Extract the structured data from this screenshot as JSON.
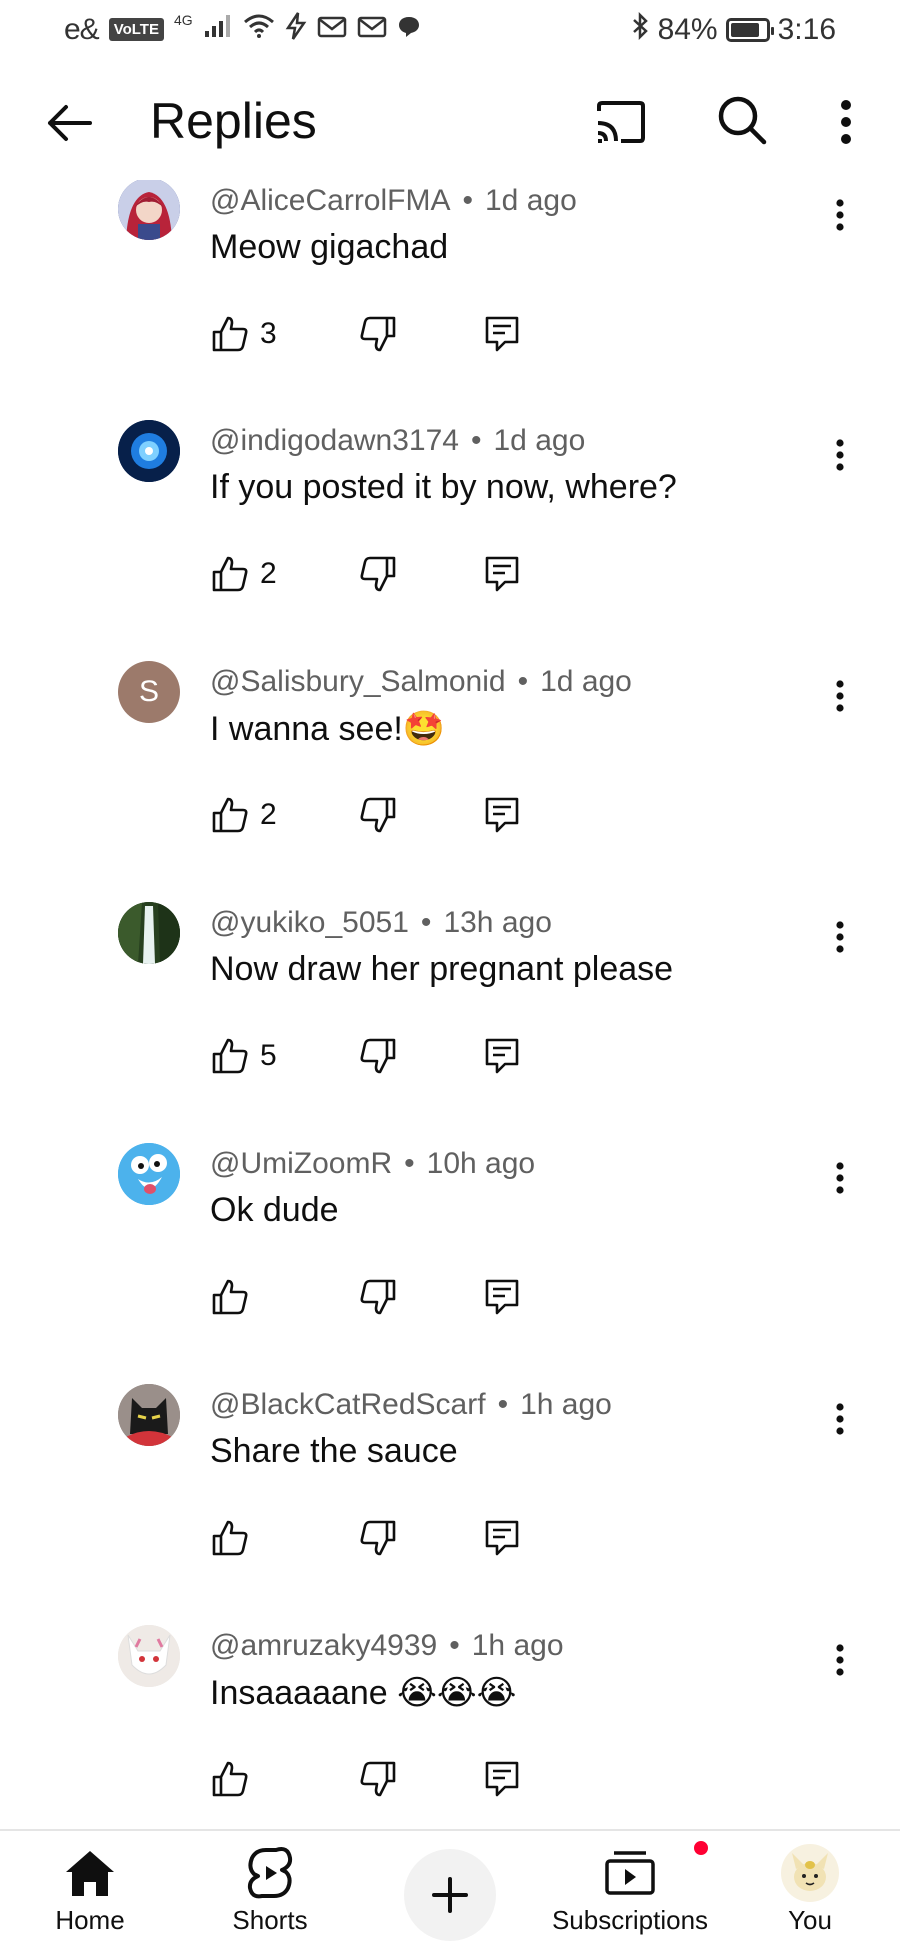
{
  "status_bar": {
    "carrier": "e&",
    "volte": "VoLTE",
    "network": "4G",
    "battery": "84%",
    "battery_level": 0.84,
    "time": "3:16"
  },
  "header": {
    "title": "Replies"
  },
  "comments": [
    {
      "handle": "@AliceCarrolFMA",
      "dot": "•",
      "time": "1d ago",
      "text": "Meow gigachad",
      "likes": "3",
      "avatar_color": "#3a4a8c"
    },
    {
      "handle": "@indigodawn3174",
      "dot": "•",
      "time": "1d ago",
      "text": "If you posted it by now, where?",
      "likes": "2",
      "avatar_color": "#1a5fb4"
    },
    {
      "handle": "@Salisbury_Salmonid",
      "dot": "•",
      "time": "1d ago",
      "text": "I wanna see!🤩",
      "likes": "2",
      "avatar_color": "#9c7a6b",
      "avatar_letter": "S"
    },
    {
      "handle": "@yukiko_5051",
      "dot": "•",
      "time": "13h ago",
      "text": "Now draw her pregnant please",
      "likes": "5",
      "avatar_color": "#2f4a2a"
    },
    {
      "handle": "@UmiZoomR",
      "dot": "•",
      "time": "10h ago",
      "text": "Ok dude",
      "likes": "",
      "avatar_color": "#3fa9e8"
    },
    {
      "handle": "@BlackCatRedScarf",
      "dot": "•",
      "time": "1h ago",
      "text": "Share the sauce",
      "likes": "",
      "avatar_color": "#8a7d78"
    },
    {
      "handle": "@amruzaky4939",
      "dot": "•",
      "time": "1h ago",
      "text": "Insaaaaane 😭😭😭",
      "likes": "",
      "avatar_color": "#e9e6e3"
    }
  ],
  "bottom_nav": {
    "home": "Home",
    "shorts": "Shorts",
    "subscriptions": "Subscriptions",
    "you": "You"
  },
  "colors": {
    "notification_dot": "#ff0033",
    "meta_text": "#606060"
  }
}
